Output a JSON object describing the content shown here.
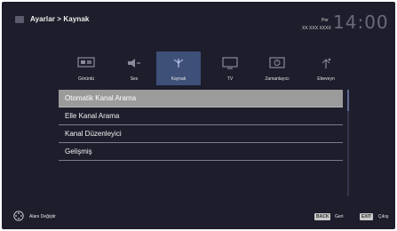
{
  "header": {
    "breadcrumb": "Ayarlar > Kaynak",
    "day": "Per",
    "date": "XX XXX XXXX",
    "time": "14:00"
  },
  "tabs": [
    {
      "label": "Görüntü",
      "icon": "display-settings-icon"
    },
    {
      "label": "Ses",
      "icon": "speaker-icon"
    },
    {
      "label": "Kaynak",
      "icon": "antenna-source-icon",
      "active": true
    },
    {
      "label": "TV",
      "icon": "tv-icon"
    },
    {
      "label": "Zamanlayıcı",
      "icon": "timer-icon"
    },
    {
      "label": "Ebeveyn",
      "icon": "parental-lock-icon"
    }
  ],
  "menu": {
    "items": [
      "Otomatik Kanal Arama",
      "Elle Kanal Arama",
      "Kanal Düzenleyici",
      "Gelişmiş"
    ],
    "selected_index": 0
  },
  "footer": {
    "hint": "Alanı Değiştir",
    "back_key": "BACK",
    "back_label": "Geri",
    "exit_key": "EXIT",
    "exit_label": "Çıkış"
  },
  "colors": {
    "background": "#1d1d2c",
    "active_tab": "#3e4f78",
    "selected_item": "#9b9b9b"
  }
}
